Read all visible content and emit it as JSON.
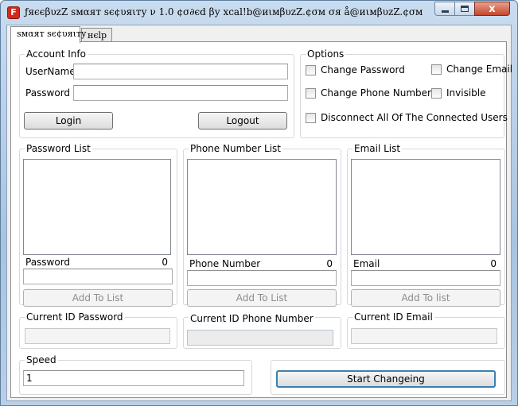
{
  "window": {
    "title": "ƒяєєβυzZ ѕмαят ѕє¢υяιту ν 1.0 ¢σ∂єd βу xcal!b@иιмβυzZ.¢σм σя å@иιмβυzZ.¢σм",
    "app_icon_letter": "F",
    "close_glyph": "x"
  },
  "tabs": [
    {
      "label": "ѕмαят ѕє¢υяιту"
    },
    {
      "label": "нєlp"
    }
  ],
  "account_info": {
    "legend": "Account Info",
    "username_label": "UserName",
    "username_value": "",
    "password_label": "Password",
    "password_value": "",
    "login_button": "Login",
    "logout_button": "Logout"
  },
  "options": {
    "legend": "Options",
    "change_password": "Change Password",
    "change_email": "Change Email",
    "change_phone": "Change Phone Number",
    "invisible": "Invisible",
    "disconnect_all": "Disconnect All Of The Connected Users"
  },
  "password_list": {
    "legend": "Password List",
    "entry_label": "Password",
    "count": "0",
    "input_value": "",
    "add_button": "Add To List"
  },
  "phone_list": {
    "legend": "Phone Number List",
    "entry_label": "Phone Number",
    "count": "0",
    "input_value": "",
    "add_button": "Add To List"
  },
  "email_list": {
    "legend": "Email List",
    "entry_label": "Email",
    "count": "0",
    "input_value": "",
    "add_button": "Add To list"
  },
  "current": {
    "password_label": "Current ID Password",
    "password_value": "",
    "phone_label": "Current ID Phone Number",
    "phone_value": "",
    "email_label": "Current ID Email",
    "email_value": ""
  },
  "speed": {
    "legend": "Speed",
    "value": "1"
  },
  "start_button": "Start Changeing"
}
